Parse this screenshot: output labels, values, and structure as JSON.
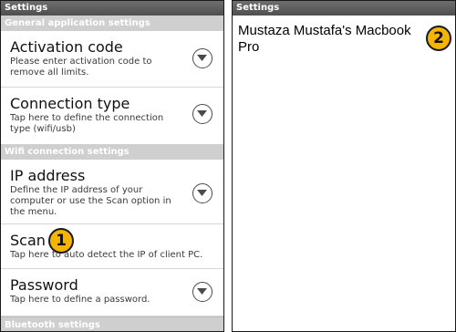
{
  "left": {
    "title": "Settings",
    "sections": [
      {
        "header": "General application settings",
        "items": [
          {
            "title": "Activation code",
            "summary": "Please enter activation code to remove all limits."
          },
          {
            "title": "Connection type",
            "summary": "Tap here to define the connection type (wifi/usb)"
          }
        ]
      },
      {
        "header": "Wifi connection settings",
        "items": [
          {
            "title": "IP address",
            "summary": "Define the IP address of your computer or use the Scan option in the menu."
          },
          {
            "title": "Scan",
            "summary": "Tap here to auto detect the IP of client PC."
          },
          {
            "title": "Password",
            "summary": "Tap here to define a password."
          }
        ]
      },
      {
        "header": "Bluetooth settings",
        "items": []
      }
    ],
    "callout": "1"
  },
  "right": {
    "title": "Settings",
    "device_name": "Mustaza Mustafa's Macbook Pro",
    "callout": "2"
  },
  "colors": {
    "title_bar": "#5a5a5a",
    "section_header": "#cfcfcf",
    "callout_fill": "#f4b400"
  },
  "icons": {
    "row_chevron": "chevron-down-circle-icon"
  }
}
